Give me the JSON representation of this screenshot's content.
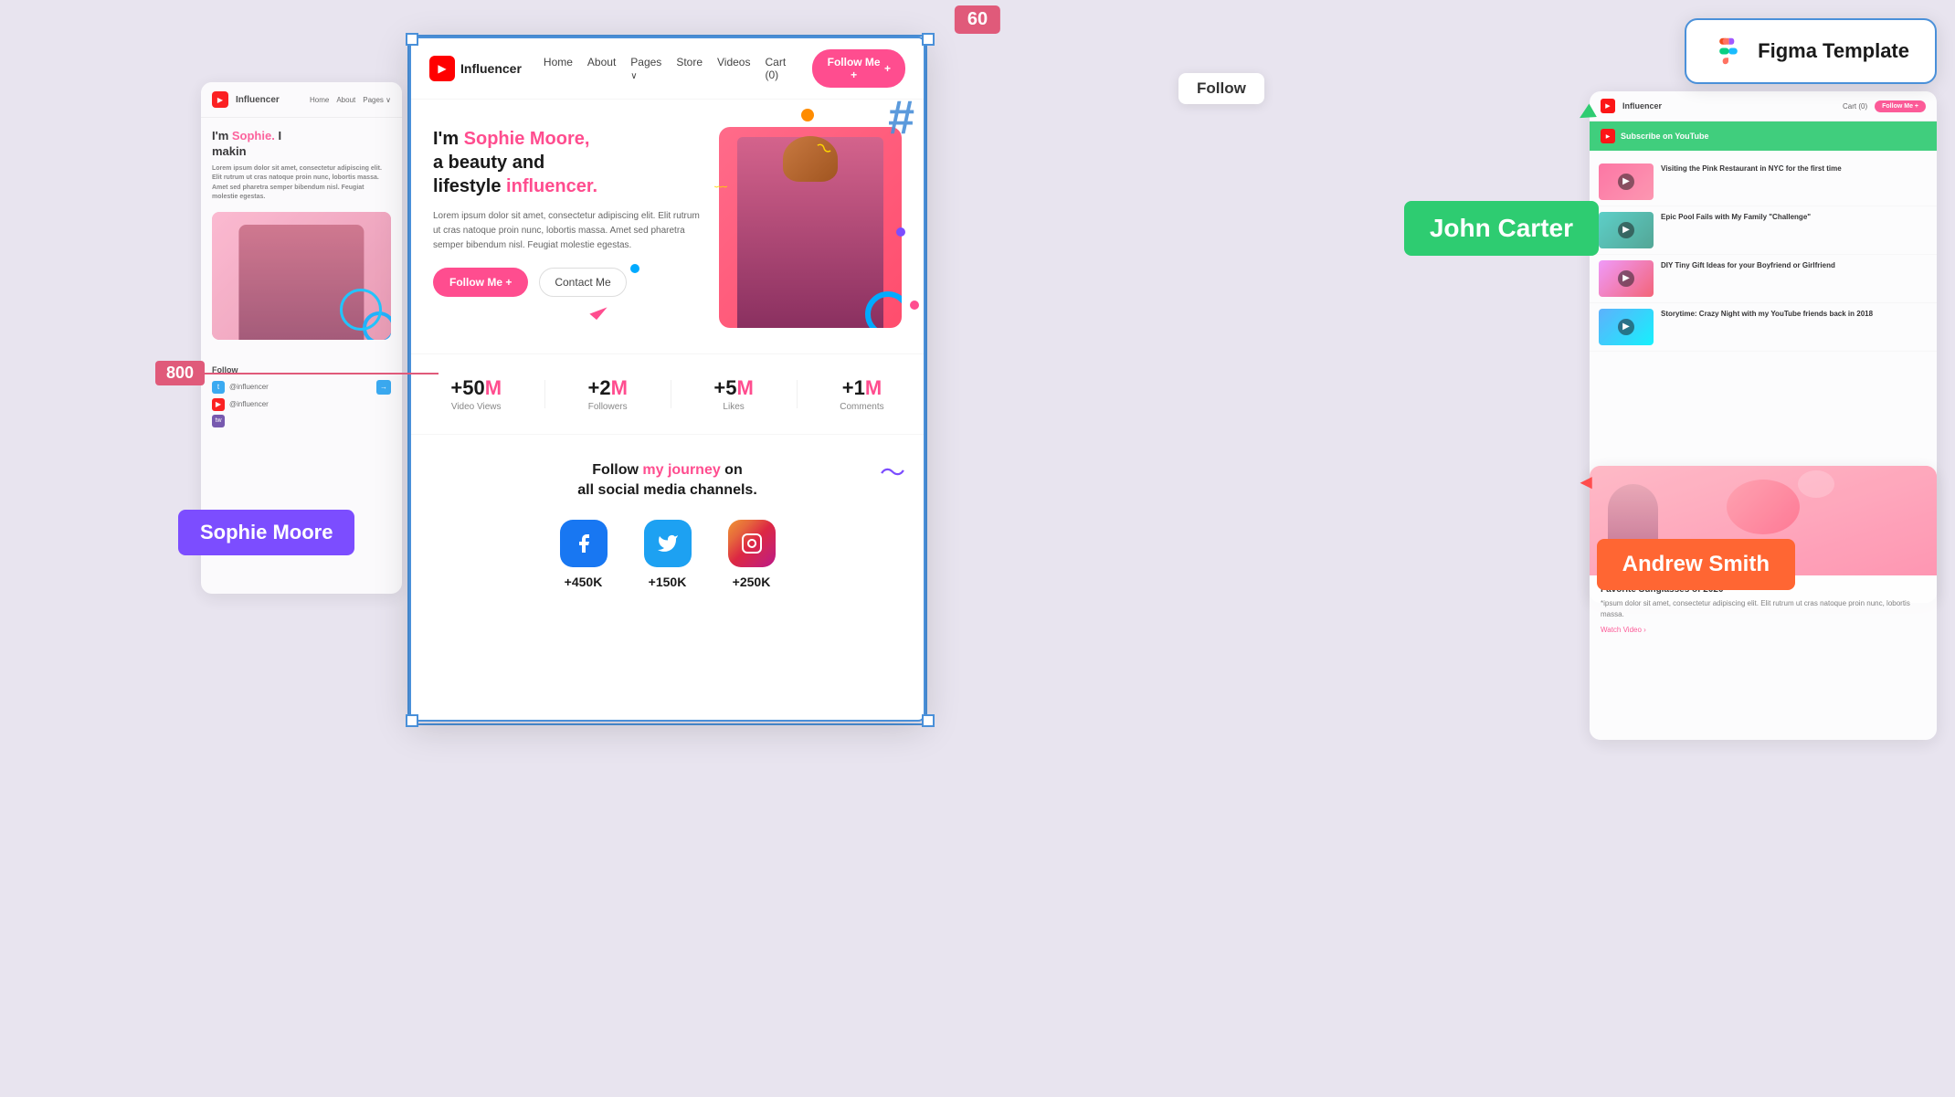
{
  "measure": {
    "top": "60",
    "left": "800"
  },
  "left_preview": {
    "brand": "Influencer",
    "nav_items": [
      "Home",
      "About",
      "Pages ∨"
    ],
    "hero_text_line1": "I'm Sophie.",
    "hero_text_line2": "I makin",
    "hero_text_highlight": "Sophie.",
    "hero_para": "Lorem ipsum dolor sit amet, consectetur adipiscing elit. Elit rutrum ut cras natoque proin nunc, lobortis massa. Amet sed pharetra semper bibendum nisl. Feugiat molestie egestas.",
    "follow_label": "Follow",
    "social_handles": [
      "@influencer",
      "@influencer"
    ],
    "social_icons_types": [
      "twitter",
      "youtube",
      "twitch"
    ]
  },
  "sophie_label": "Sophie Moore",
  "john_label": "John Carter",
  "andrew_label": "Andrew Smith",
  "follow_button": "Follow",
  "figma_template": "Figma Template",
  "main_frame": {
    "brand": "Influencer",
    "nav_links": [
      "Home",
      "About",
      "Pages",
      "Store",
      "Videos"
    ],
    "cart": "Cart (0)",
    "follow_btn": "Follow Me +",
    "hero_heading_1": "I'm ",
    "hero_heading_highlight": "Sophie Moore,",
    "hero_heading_2": "a beauty and lifestyle",
    "hero_heading_influencer": " influencer.",
    "hero_para": "Lorem ipsum dolor sit amet, consectetur adipiscing elit. Elit rutrum ut cras natoque proin nunc, lobortis massa. Amet sed pharetra semper bibendum nisl. Feugiat molestie egestas.",
    "follow_btn2": "Follow Me +",
    "contact_btn": "Contact Me",
    "stats": [
      {
        "number": "+50",
        "suffix": "M",
        "label": "Video Views"
      },
      {
        "number": "+2",
        "suffix": "M",
        "label": "Followers"
      },
      {
        "number": "+5",
        "suffix": "M",
        "label": "Likes"
      },
      {
        "number": "+1",
        "suffix": "M",
        "label": "Comments"
      }
    ],
    "social_heading_1": "Follow ",
    "social_heading_highlight": "my journey",
    "social_heading_2": " on",
    "social_heading_3": "all social media channels.",
    "social_items": [
      {
        "platform": "Facebook",
        "count": "+450K"
      },
      {
        "platform": "Twitter",
        "count": "+150K"
      },
      {
        "platform": "Instagram",
        "count": "+250K"
      }
    ]
  },
  "right_preview": {
    "brand": "Influencer",
    "cart": "Cart (0)",
    "follow_btn": "Follow Me +",
    "subscribe_text": "Subscribe on YouTube",
    "videos": [
      {
        "title": "Visiting the Pink Restaurant in NYC for the first time"
      },
      {
        "title": "Epic Pool Fails with My Family \"Challenge\""
      },
      {
        "title": "DIY Tiny Gift Ideas for your Boyfriend or Girlfriend"
      },
      {
        "title": "Storytime: Crazy Night with my YouTube friends back in 2018"
      }
    ]
  },
  "rb_preview": {
    "title": "Favorite Sunglasses of 2020",
    "desc": "*ipsum dolor sit amet, consectetur adipiscing elit. Elit rutrum ut cras natoque proin nunc, lobortis massa.",
    "link": "Watch Video ›"
  }
}
